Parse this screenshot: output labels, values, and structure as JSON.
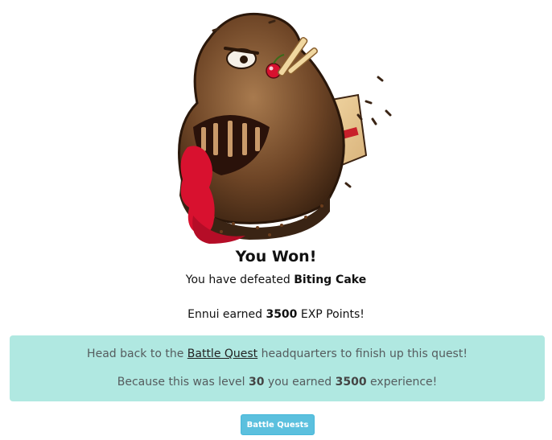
{
  "result": {
    "title": "You Won!",
    "defeat_prefix": "You have defeated",
    "monster_name": "Biting Cake",
    "earned_name": "Ennui",
    "earned_mid": "earned",
    "exp_points": "3500",
    "earned_suffix": "EXP Points!"
  },
  "notice": {
    "line1_prefix": "Head back to the",
    "link_text": "Battle Quest",
    "line1_suffix": "headquarters to finish up this quest!",
    "line2_prefix": "Because this was level",
    "level": "30",
    "line2_mid": "you earned",
    "experience": "3500",
    "line2_suffix": "experience!"
  },
  "button": {
    "label": "Battle Quests"
  },
  "colors": {
    "notice_bg": "#b0e8e1",
    "button_bg": "#5bc0de"
  }
}
